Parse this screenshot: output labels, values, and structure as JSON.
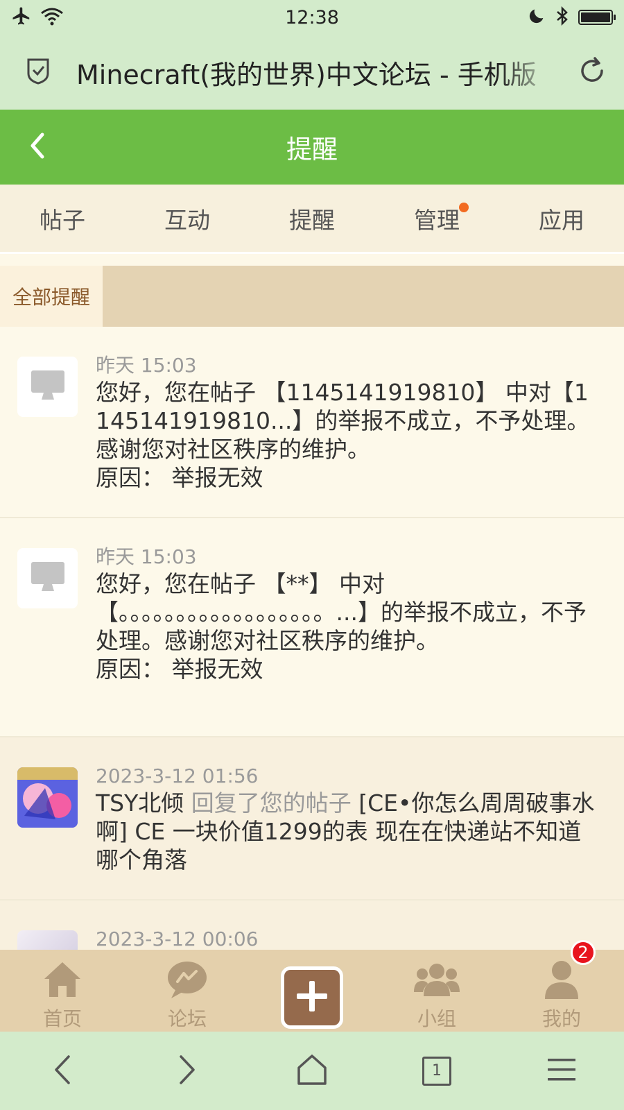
{
  "status_bar": {
    "time": "12:38"
  },
  "browser": {
    "page_title": "Minecraft(我的世界)中文论坛 - 手机版",
    "tab_count": "1"
  },
  "header": {
    "title": "提醒"
  },
  "tabs": [
    {
      "label": "帖子"
    },
    {
      "label": "互动"
    },
    {
      "label": "提醒"
    },
    {
      "label": "管理",
      "has_dot": true
    },
    {
      "label": "应用"
    }
  ],
  "filter": {
    "active_label": "全部提醒"
  },
  "notifications": [
    {
      "type": "system",
      "time": "昨天 15:03",
      "text": "您好，您在帖子 【1145141919810】 中对【1145141919810...】的举报不成立，不予处理。感谢您对社区秩序的维护。",
      "reason": "原因：  举报无效"
    },
    {
      "type": "system",
      "time": "昨天 15:03",
      "text": "您好，您在帖子 【**】 中对【。。。。。。。。。。。。。。。。。。...】的举报不成立，不予处理。感谢您对社区秩序的维护。",
      "reason": "原因：  举报无效"
    },
    {
      "type": "user",
      "time": "2023-3-12 01:56",
      "user": "TSY北倾",
      "action": "回复了您的帖子",
      "content": "[CE•你怎么周周破事水啊] CE 一块价值1299的表 现在在快递站不知道哪个角落"
    },
    {
      "type": "user",
      "time": "2023-3-12 00:06"
    }
  ],
  "bottom_nav": [
    {
      "label": "首页",
      "icon": "home-icon"
    },
    {
      "label": "论坛",
      "icon": "forum-icon"
    },
    {
      "label": "",
      "icon": "plus-icon"
    },
    {
      "label": "小组",
      "icon": "group-icon"
    },
    {
      "label": "我的",
      "icon": "profile-icon",
      "badge": "2"
    }
  ],
  "colors": {
    "header_green": "#6cbd45",
    "browser_green": "#d3ebcb",
    "tab_dot": "#f26b21",
    "badge_red": "#e8141e",
    "fab_brown": "#956a4c"
  }
}
